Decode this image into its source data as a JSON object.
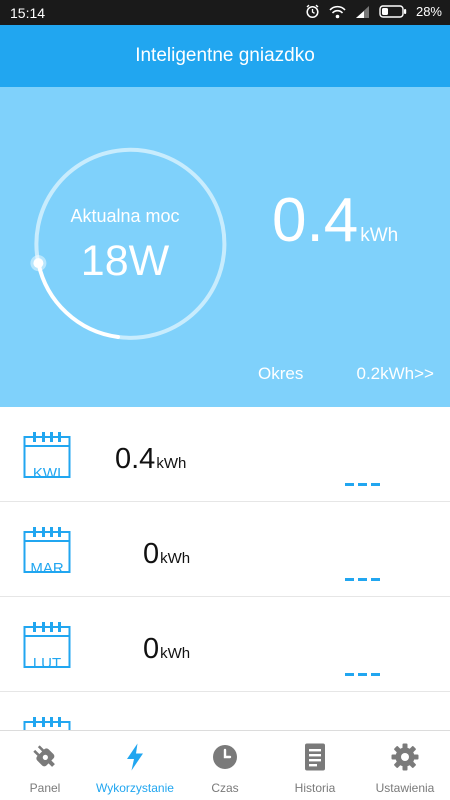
{
  "status_bar": {
    "time": "15:14",
    "battery": "28%",
    "icons": [
      "alarm-icon",
      "wifi-icon",
      "signal-icon",
      "battery-icon"
    ]
  },
  "header": {
    "title": "Inteligentne gniazdko"
  },
  "hero": {
    "power_label": "Aktualna moc",
    "power_value": "18W",
    "energy_value": "0.4",
    "energy_unit": "kWh",
    "period_label": "Okres",
    "period_link": "0.2kWh>>"
  },
  "months": [
    {
      "month": "KWI",
      "value": "0.4",
      "unit": "kWh"
    },
    {
      "month": "MAR",
      "value": "0",
      "unit": "kWh"
    },
    {
      "month": "LUT",
      "value": "0",
      "unit": "kWh"
    },
    {
      "month": "",
      "value": "",
      "unit": ""
    }
  ],
  "nav": {
    "items": [
      {
        "label": "Panel",
        "icon": "plug-icon"
      },
      {
        "label": "Wykorzystanie",
        "icon": "lightning-icon"
      },
      {
        "label": "Czas",
        "icon": "clock-icon"
      },
      {
        "label": "Historia",
        "icon": "document-icon"
      },
      {
        "label": "Ustawienia",
        "icon": "gear-icon"
      }
    ],
    "active": "Wykorzystanie"
  },
  "colors": {
    "accent": "#21a6f0",
    "hero_background": "#7fd1fb",
    "status_bar": "#1a1a1a"
  }
}
